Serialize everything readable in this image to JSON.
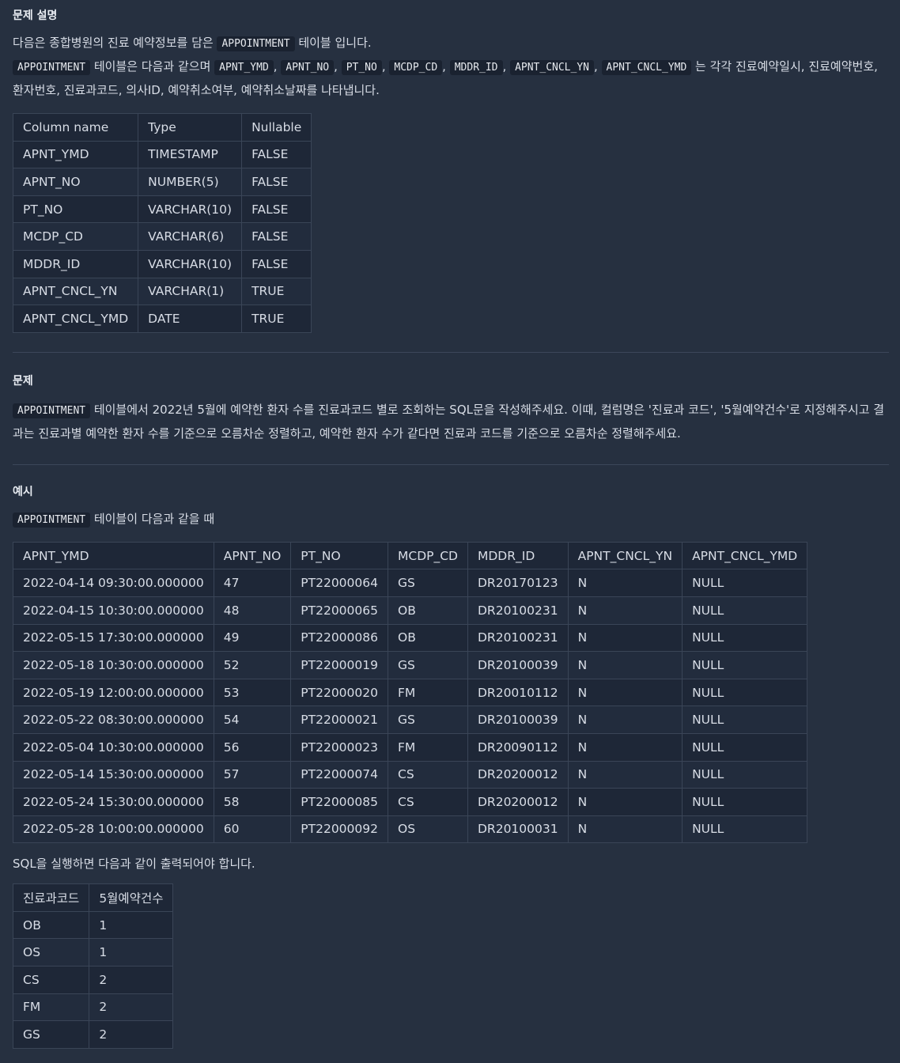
{
  "section1": {
    "title": "문제 설명",
    "p1_pre": "다음은 종합병원의 진료 예약정보를 담은 ",
    "p1_code": "APPOINTMENT",
    "p1_post": " 테이블 입니다.",
    "p2_code0": "APPOINTMENT",
    "p2_mid": " 테이블은 다음과 같으며 ",
    "p2_codes": [
      "APNT_YMD",
      "APNT_NO",
      "PT_NO",
      "MCDP_CD",
      "MDDR_ID",
      "APNT_CNCL_YN",
      "APNT_CNCL_YMD"
    ],
    "p2_sep": ", ",
    "p2_post": " 는 각각 진료예약일시, 진료예약번호, 환자번호, 진료과코드, 의사ID, 예약취소여부, 예약취소날짜를 나타냅니다.",
    "schema_headers": [
      "Column name",
      "Type",
      "Nullable"
    ],
    "schema_rows": [
      [
        "APNT_YMD",
        "TIMESTAMP",
        "FALSE"
      ],
      [
        "APNT_NO",
        "NUMBER(5)",
        "FALSE"
      ],
      [
        "PT_NO",
        "VARCHAR(10)",
        "FALSE"
      ],
      [
        "MCDP_CD",
        "VARCHAR(6)",
        "FALSE"
      ],
      [
        "MDDR_ID",
        "VARCHAR(10)",
        "FALSE"
      ],
      [
        "APNT_CNCL_YN",
        "VARCHAR(1)",
        "TRUE"
      ],
      [
        "APNT_CNCL_YMD",
        "DATE",
        "TRUE"
      ]
    ]
  },
  "section2": {
    "title": "문제",
    "code": "APPOINTMENT",
    "text": " 테이블에서 2022년 5월에 예약한 환자 수를 진료과코드 별로 조회하는 SQL문을 작성해주세요. 이때, 컬럼명은 '진료과 코드', '5월예약건수'로 지정해주시고 결과는 진료과별 예약한 환자 수를 기준으로 오름차순 정렬하고, 예약한 환자 수가 같다면 진료과 코드를 기준으로 오름차순 정렬해주세요."
  },
  "section3": {
    "title": "예시",
    "code": "APPOINTMENT",
    "intro_post": " 테이블이 다음과 같을 때",
    "example_headers": [
      "APNT_YMD",
      "APNT_NO",
      "PT_NO",
      "MCDP_CD",
      "MDDR_ID",
      "APNT_CNCL_YN",
      "APNT_CNCL_YMD"
    ],
    "example_rows": [
      [
        "2022-04-14 09:30:00.000000",
        "47",
        "PT22000064",
        "GS",
        "DR20170123",
        "N",
        "NULL"
      ],
      [
        "2022-04-15 10:30:00.000000",
        "48",
        "PT22000065",
        "OB",
        "DR20100231",
        "N",
        "NULL"
      ],
      [
        "2022-05-15 17:30:00.000000",
        "49",
        "PT22000086",
        "OB",
        "DR20100231",
        "N",
        "NULL"
      ],
      [
        "2022-05-18 10:30:00.000000",
        "52",
        "PT22000019",
        "GS",
        "DR20100039",
        "N",
        "NULL"
      ],
      [
        "2022-05-19 12:00:00.000000",
        "53",
        "PT22000020",
        "FM",
        "DR20010112",
        "N",
        "NULL"
      ],
      [
        "2022-05-22 08:30:00.000000",
        "54",
        "PT22000021",
        "GS",
        "DR20100039",
        "N",
        "NULL"
      ],
      [
        "2022-05-04 10:30:00.000000",
        "56",
        "PT22000023",
        "FM",
        "DR20090112",
        "N",
        "NULL"
      ],
      [
        "2022-05-14 15:30:00.000000",
        "57",
        "PT22000074",
        "CS",
        "DR20200012",
        "N",
        "NULL"
      ],
      [
        "2022-05-24 15:30:00.000000",
        "58",
        "PT22000085",
        "CS",
        "DR20200012",
        "N",
        "NULL"
      ],
      [
        "2022-05-28 10:00:00.000000",
        "60",
        "PT22000092",
        "OS",
        "DR20100031",
        "N",
        "NULL"
      ]
    ],
    "result_intro": "SQL을 실행하면 다음과 같이 출력되어야 합니다.",
    "result_headers": [
      "진료과코드",
      "5월예약건수"
    ],
    "result_rows": [
      [
        "OB",
        "1"
      ],
      [
        "OS",
        "1"
      ],
      [
        "CS",
        "2"
      ],
      [
        "FM",
        "2"
      ],
      [
        "GS",
        "2"
      ]
    ]
  }
}
